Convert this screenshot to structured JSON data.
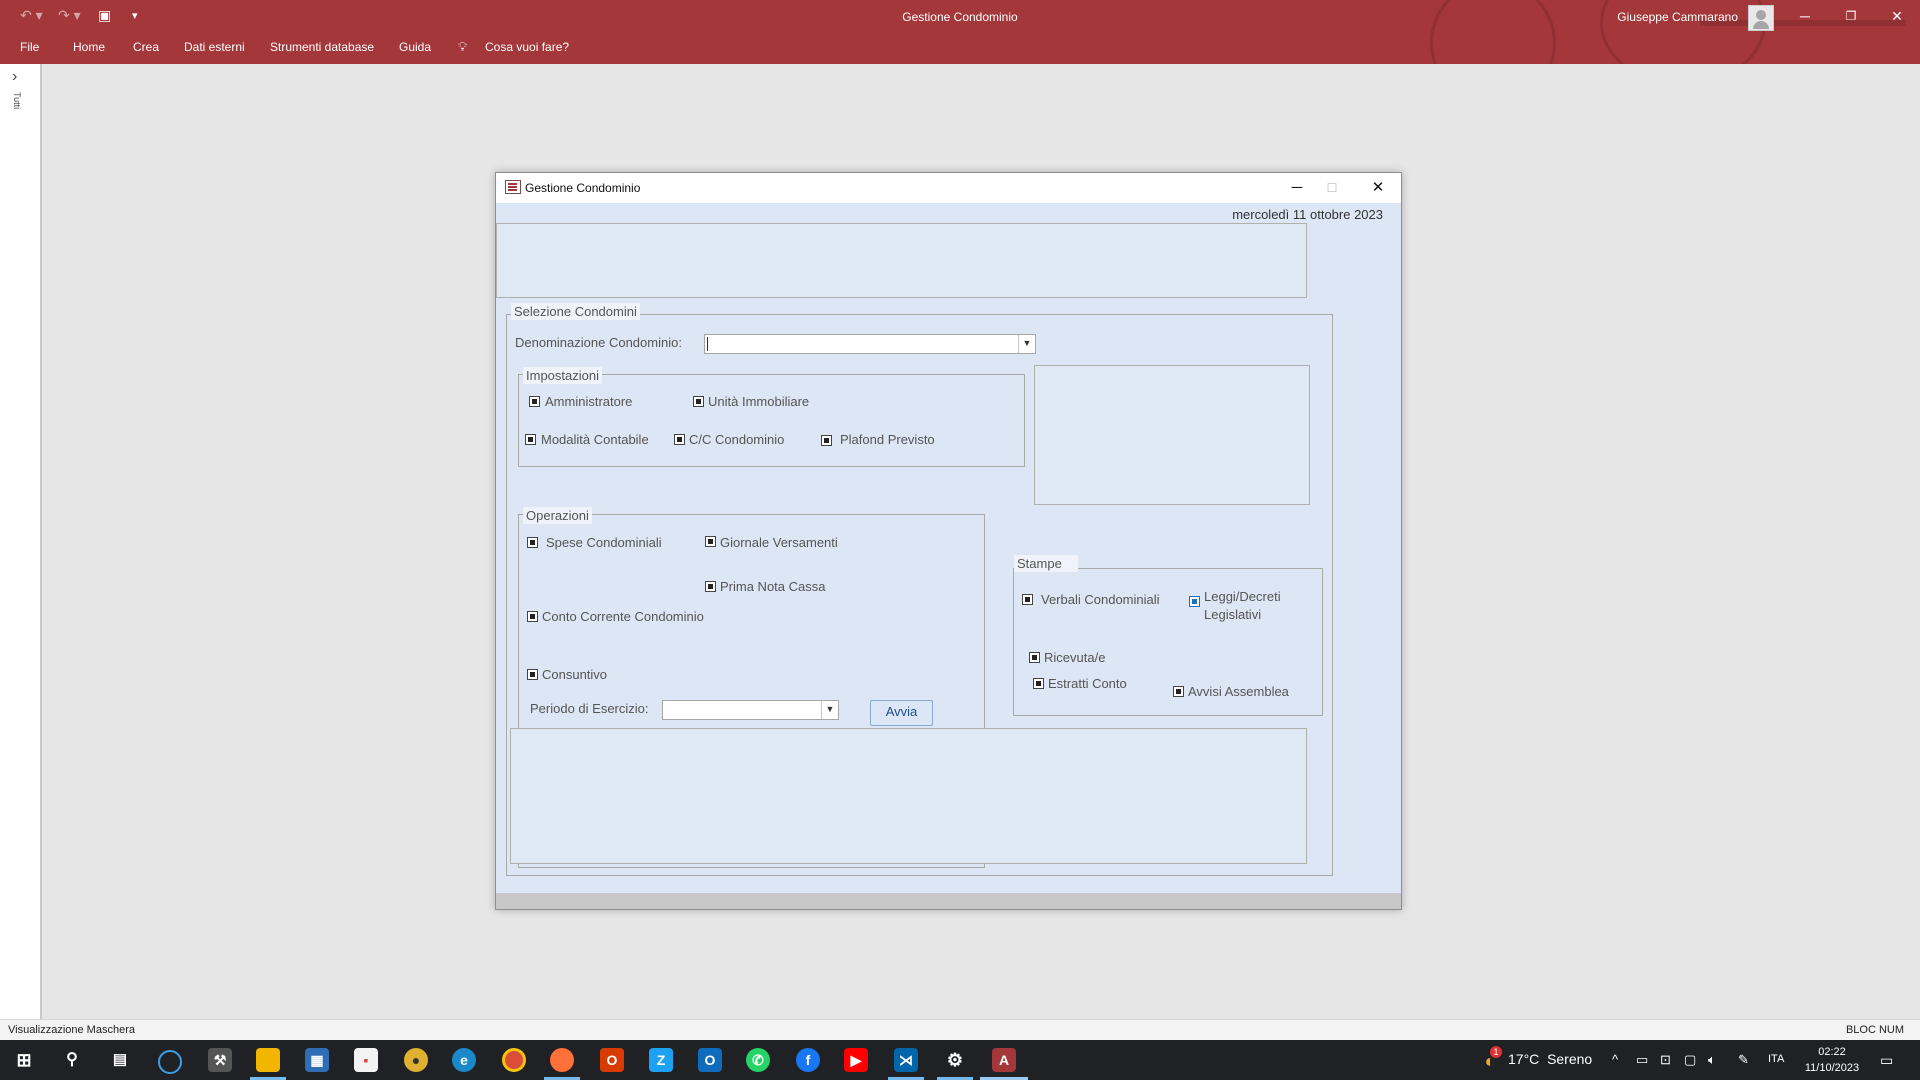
{
  "app": {
    "title": "Gestione Condominio",
    "user": "Giuseppe Cammarano",
    "ribbon_tabs": [
      "File",
      "Home",
      "Crea",
      "Dati esterni",
      "Strumenti database",
      "Guida",
      "Cosa vuoi fare?"
    ],
    "nav_pane_label": "Tutti"
  },
  "form": {
    "title": "Gestione Condominio",
    "date": "mercoledì 11 ottobre 2023",
    "selezione": {
      "legend": "Selezione Condomini",
      "denominazione_label": "Denominazione Condominio:",
      "denominazione_value": ""
    },
    "impostazioni": {
      "legend": "Impostazioni",
      "items": [
        "Amministratore",
        "Unità Immobiliare",
        "Modalità Contabile",
        "C/C Condominio",
        "Plafond Previsto"
      ]
    },
    "operazioni": {
      "legend": "Operazioni",
      "items": [
        "Spese Condominiali",
        "Giornale Versamenti",
        "Prima Nota Cassa",
        "Conto Corrente Condominio",
        "Consuntivo"
      ],
      "periodo_label": "Periodo di Esercizio:",
      "periodo_value": "",
      "avvia_button": "Avvia"
    },
    "stampe": {
      "legend": "Stampe",
      "items": [
        "Verbali Condominiali",
        "Leggi/Decreti\nLegislativi",
        "Ricevuta/e",
        "Estratti Conto",
        "Avvisi Assemblea"
      ]
    }
  },
  "statusbar": {
    "left": "Visualizzazione Maschera",
    "right": "BLOC NUM"
  },
  "taskbar": {
    "weather_temp": "17°C",
    "weather_desc": "Sereno",
    "language": "ITA",
    "time": "02:22",
    "date": "11/10/2023",
    "notification_badge": "1"
  }
}
